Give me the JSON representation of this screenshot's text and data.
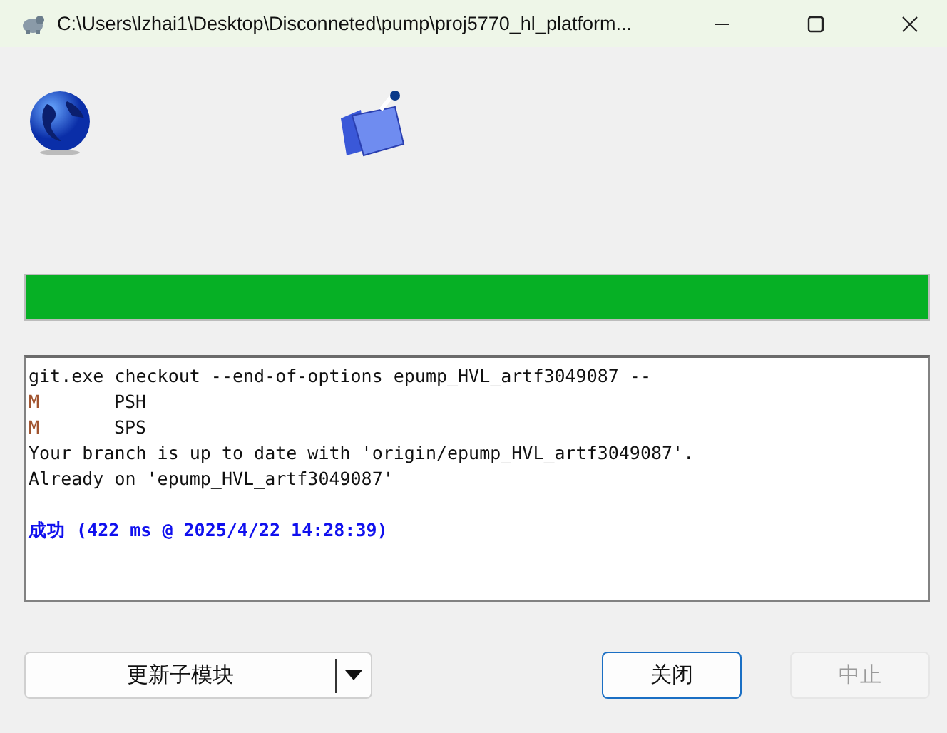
{
  "window": {
    "title": "C:\\Users\\lzhai1\\Desktop\\Disconneted\\pump\\proj5770_hl_platform..."
  },
  "progress": {
    "level": 1
  },
  "log": [
    {
      "kind": "plain",
      "text": "git.exe checkout --end-of-options epump_HVL_artf3049087 --"
    },
    {
      "kind": "modified",
      "status": "M",
      "path": "PSH"
    },
    {
      "kind": "modified",
      "status": "M",
      "path": "SPS"
    },
    {
      "kind": "plain",
      "text": "Your branch is up to date with 'origin/epump_HVL_artf3049087'."
    },
    {
      "kind": "plain",
      "text": "Already on 'epump_HVL_artf3049087'"
    },
    {
      "kind": "blank"
    },
    {
      "kind": "success",
      "text": "成功 (422 ms @ 2025/4/22 14:28:39)"
    }
  ],
  "buttons": [
    {
      "kind": "split",
      "label": "更新子模块",
      "disabled": false,
      "default": false
    },
    {
      "kind": "plain",
      "label": "关闭",
      "disabled": false,
      "default": true
    },
    {
      "kind": "plain",
      "label": "中止",
      "disabled": true,
      "default": false
    }
  ]
}
